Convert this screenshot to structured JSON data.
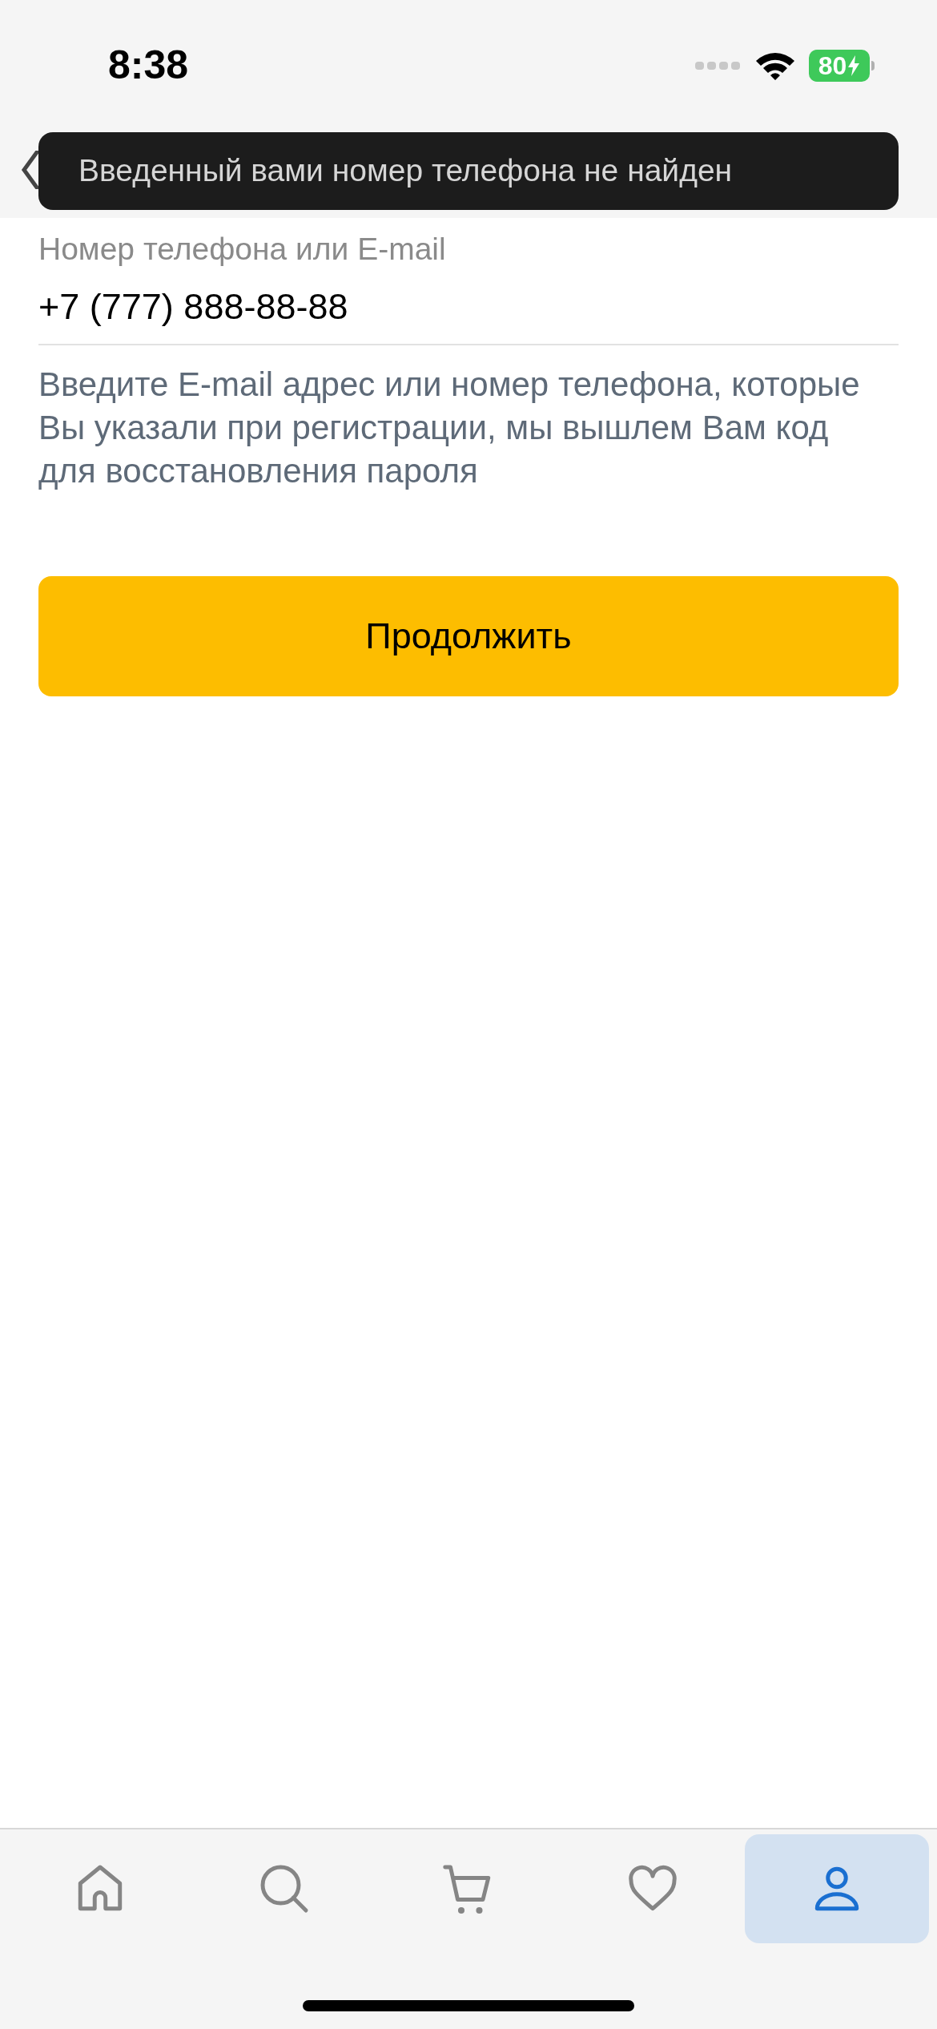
{
  "status_bar": {
    "time": "8:38",
    "battery": "80",
    "charging": true
  },
  "toast": {
    "message": "Введенный вами номер телефона не найден"
  },
  "field": {
    "label": "Номер телефона или E-mail",
    "value": "+7 (777) 888-88-88"
  },
  "hint": "Введите E-mail адрес или номер телефона, которые Вы указали при регистрации, мы вышлем Вам код для восстановления пароля",
  "continue_button": "Продолжить",
  "tab_bar": [
    {
      "selected": false
    },
    {
      "selected": false
    },
    {
      "selected": false
    },
    {
      "selected": false
    },
    {
      "selected": true
    }
  ]
}
